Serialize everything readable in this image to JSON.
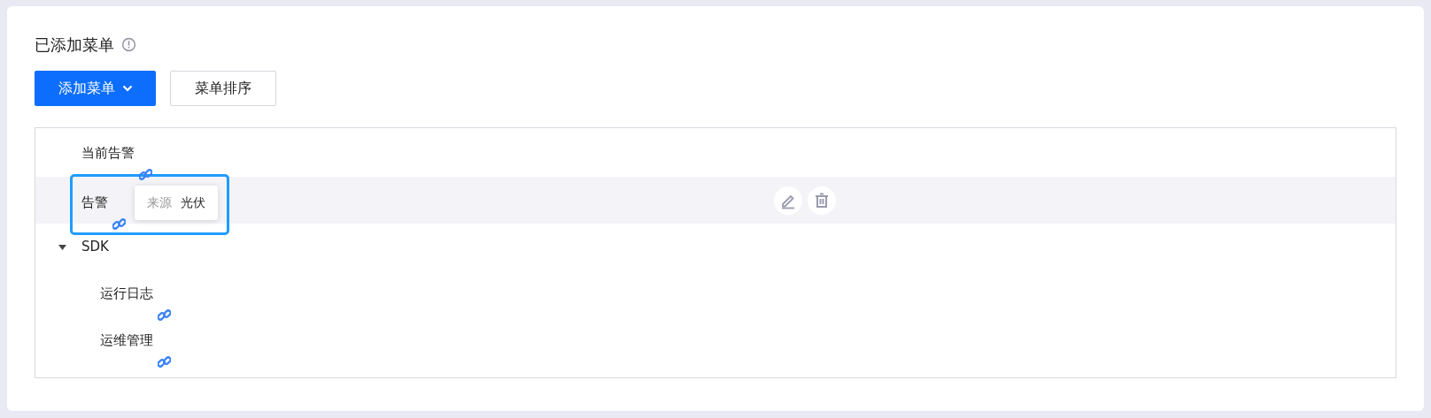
{
  "section": {
    "title": "已添加菜单"
  },
  "buttons": [
    {
      "label": "添加菜单",
      "kind": "dropdown"
    },
    {
      "label": "菜单排序",
      "kind": "plain"
    }
  ],
  "tree": [
    {
      "label": "当前告警",
      "kind": "link",
      "selected": false
    },
    {
      "label": "告警",
      "kind": "link",
      "selected": true,
      "popover": {
        "label": "来源",
        "value": "光伏"
      }
    },
    {
      "label": "SDK",
      "kind": "group",
      "expanded": true,
      "children": [
        {
          "label": "运行日志",
          "kind": "link",
          "selected": false
        },
        {
          "label": "运维管理",
          "kind": "link",
          "selected": false
        }
      ]
    }
  ]
}
